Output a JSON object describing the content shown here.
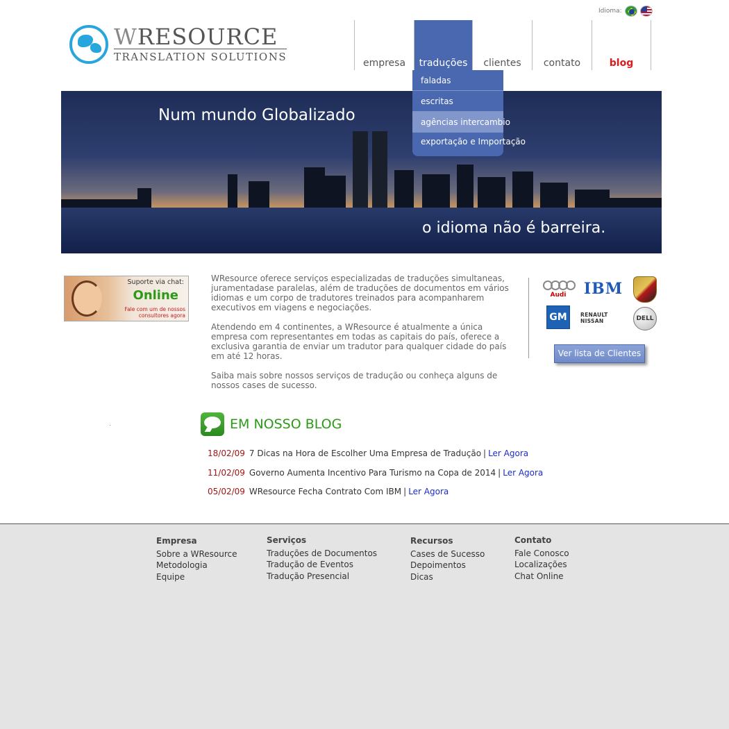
{
  "language": {
    "label": "Idioma:",
    "flags": [
      "flag-brazil-icon",
      "flag-usa-icon"
    ]
  },
  "logo": {
    "title_w": "W",
    "title_rest": "RESOURCE",
    "subtitle": "TRANSLATION SOLUTIONS"
  },
  "nav": {
    "items": [
      {
        "label": "empresa"
      },
      {
        "label": "traduções"
      },
      {
        "label": "clientes"
      },
      {
        "label": "contato"
      },
      {
        "label": "blog"
      }
    ]
  },
  "dropdown": {
    "items": [
      {
        "label": "faladas"
      },
      {
        "label": "escritas"
      },
      {
        "label": "agências intercambio"
      },
      {
        "label": "exportação e Importação"
      }
    ]
  },
  "banner": {
    "headline": "Num mundo Globalizado",
    "tagline": "o idioma não é barreira."
  },
  "chat": {
    "label": "Suporte via chat:",
    "status": "Online",
    "cta_line1": "Fale com um de nossos",
    "cta_line2": "consultores agora"
  },
  "intro": {
    "p1": "WResource oferece serviços especializadas de traduções simultaneas, juramentadase paralelas, além de traduções de documentos em vários idiomas e um corpo de tradutores treinados para acompanharem executivos em viagens e negociações.",
    "p2": "Atendendo em 4 continentes, a WResource é atualmente a única empresa com representantes em todas as capitais do país, oferece a exclusiva garantia de enviar um tradutor para qualquer cidade do país em até 12 horas.",
    "p3": "Saiba mais sobre nossos serviços de tradução ou conheça alguns de nossos cases de sucesso."
  },
  "clients": {
    "logos": {
      "audi": "Audi",
      "ibm": "IBM",
      "gm": "GM",
      "renault_nissan": "RENAULT NISSAN",
      "dell": "DELL"
    },
    "button": "Ver lista de Clientes"
  },
  "blog": {
    "title": "EM NOSSO BLOG",
    "posts": [
      {
        "date": "18/02/09",
        "title": "7 Dicas na Hora de Escolher Uma Empresa de Tradução",
        "sep": "|",
        "link": "Ler Agora"
      },
      {
        "date": "11/02/09",
        "title": "Governo Aumenta Incentivo Para Turismo na Copa de 2014",
        "sep": "|",
        "link": "Ler Agora"
      },
      {
        "date": "05/02/09",
        "title": "WResource Fecha Contrato Com IBM",
        "sep": "|",
        "link": "Ler Agora"
      }
    ]
  },
  "footer": {
    "columns": [
      {
        "heading": "Empresa",
        "links": [
          "Sobre a WResource",
          "Metodologia",
          "Equipe"
        ]
      },
      {
        "heading": "Serviços",
        "links": [
          "Traduções de Documentos",
          "Tradução de Eventos",
          "Tradução Presencial"
        ]
      },
      {
        "heading": "Recursos",
        "links": [
          "Cases de Sucesso",
          "Depoimentos",
          "Dicas"
        ]
      },
      {
        "heading": "Contato",
        "links": [
          "Fale Conosco",
          "Localizações",
          "Chat Online"
        ]
      }
    ]
  }
}
